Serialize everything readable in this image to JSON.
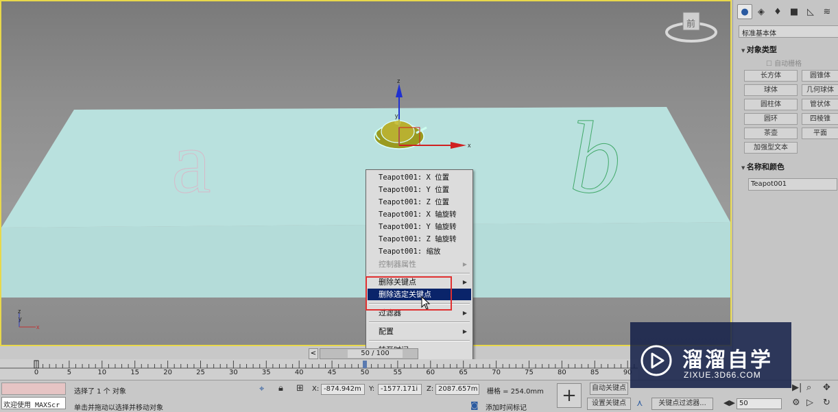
{
  "viewport": {
    "label_a": "a",
    "label_b": "b",
    "gizmo_axes": {
      "x": "x",
      "y": "y",
      "z": "z"
    },
    "corner_axes": {
      "x": "x",
      "y": "y",
      "z": "z"
    },
    "viewcube_face": "前"
  },
  "context_menu": {
    "items": [
      {
        "label": "Teapot001: X 位置"
      },
      {
        "label": "Teapot001: Y 位置"
      },
      {
        "label": "Teapot001: Z 位置"
      },
      {
        "label": "Teapot001: X 轴旋转"
      },
      {
        "label": "Teapot001: Y 轴旋转"
      },
      {
        "label": "Teapot001: Z 轴旋转"
      },
      {
        "label": "Teapot001: 缩放"
      },
      {
        "label": "控制器属性"
      }
    ],
    "delete_keys": "删除关键点",
    "delete_selected_keys": "删除选定关键点",
    "filters": "过滤器",
    "configure": "配置",
    "goto_time": "转至时间"
  },
  "command_panel": {
    "category_dropdown": "标准基本体",
    "object_type_title": "对象类型",
    "auto_grid": "自动栅格",
    "buttons": [
      "长方体",
      "圆锥体",
      "球体",
      "几何球体",
      "圆柱体",
      "管状体",
      "圆环",
      "四棱锥",
      "茶壶",
      "平面",
      "加强型文本"
    ],
    "name_color_title": "名称和颜色",
    "object_name": "Teapot001"
  },
  "timeline": {
    "slider_text": "50 / 100",
    "prev": "<",
    "ticks": [
      "0",
      "5",
      "10",
      "15",
      "20",
      "25",
      "30",
      "35",
      "40",
      "45",
      "50",
      "55",
      "60",
      "65",
      "70",
      "75",
      "80",
      "85",
      "90"
    ]
  },
  "status_bar": {
    "maxscript": "欢迎使用 MAXScr",
    "selection_status": "选择了 1 个 对象",
    "prompt": "单击并拖动以选择并移动对象",
    "x_label": "X:",
    "x_value": "-874.942m",
    "y_label": "Y:",
    "y_value": "-1577.171i",
    "z_label": "Z:",
    "z_value": "2087.657m",
    "grid": "栅格 = 254.0mm",
    "add_time_tag": "添加时间标记",
    "auto_key": "自动关键点",
    "set_key": "设置关键点",
    "key_filters": "关键点过滤器...",
    "frame": "50"
  },
  "watermark": {
    "brand": "溜溜自学",
    "url": "ZIXUE.3D66.COM"
  },
  "colors": {
    "plane": "#b9e1de",
    "highlight": "#0a246a",
    "redbox": "#e03030",
    "viewport_border": "#e8d84a",
    "watermark_bg": "#142048"
  }
}
